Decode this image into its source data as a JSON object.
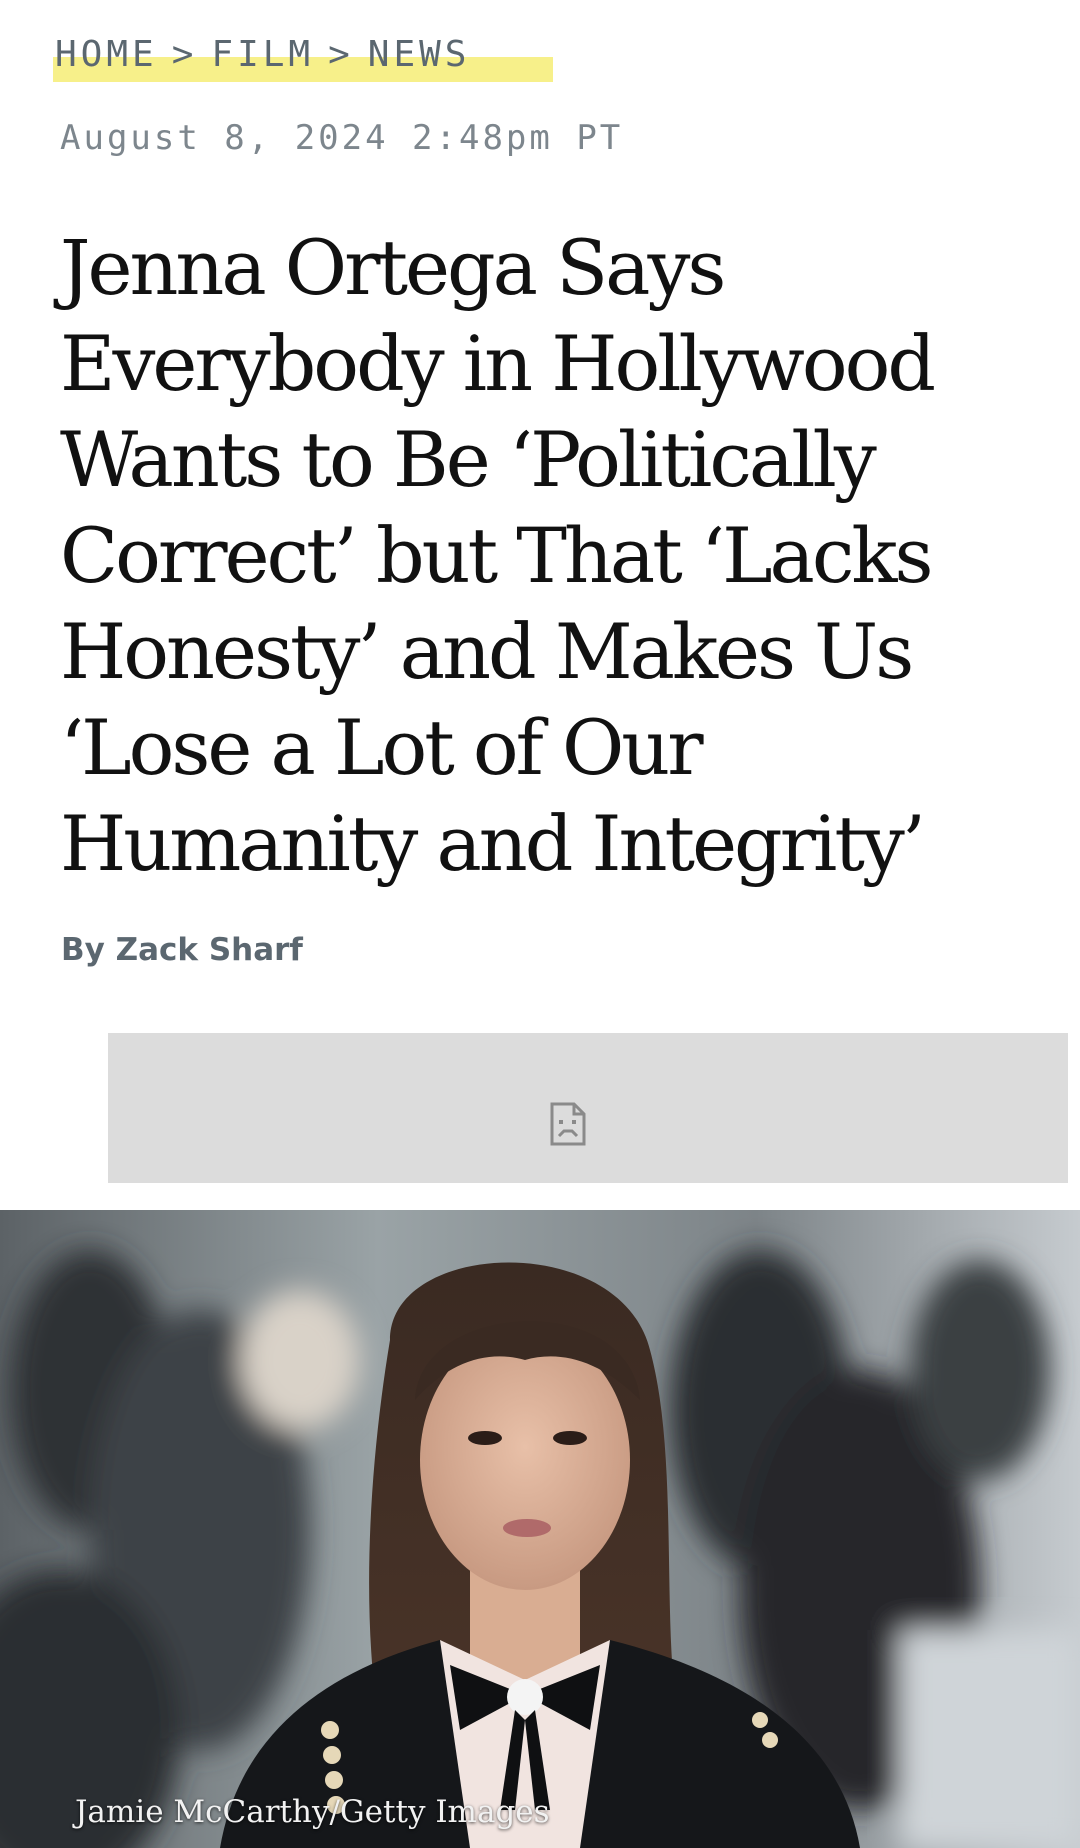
{
  "breadcrumb": {
    "items": [
      "HOME",
      "FILM",
      "NEWS"
    ],
    "separator": ">",
    "highlight_color": "#f7f08a"
  },
  "article": {
    "dateline": "August 8, 2024 2:48pm PT",
    "headline": "Jenna Ortega Says Everybody in Hollywood Wants to Be ‘Politically Correct’ but That ‘Lacks Honesty’ and Makes Us ‘Lose a Lot of Our Humanity and Integrity’",
    "byline_prefix": "By",
    "author": "Zack Sharf"
  },
  "ad": {
    "icon": "broken-image-icon",
    "background": "#dcdcdc"
  },
  "hero_image": {
    "credit": "Jamie McCarthy/Getty Images"
  }
}
